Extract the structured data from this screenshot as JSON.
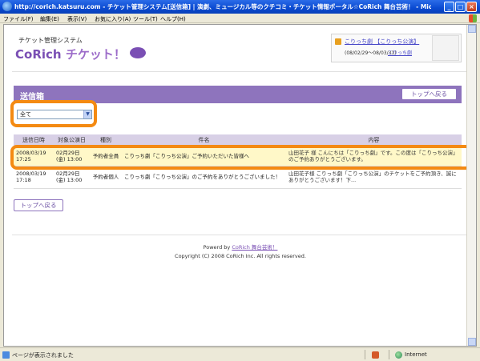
{
  "window": {
    "title": "http://corich.katsuru.com - チケット管理システム[送信箱] | 演劇、ミュージカル等のクチコミ・チケット情報ポータル☆CoRich 舞台芸術！ - Microsoft Inter",
    "minimize": "_",
    "maximize": "□",
    "close": "×"
  },
  "menu": {
    "items": [
      "ファイル(F)",
      "編集(E)",
      "表示(V)",
      "お気に入り(A)",
      "ツール(T)",
      "ヘルプ(H)"
    ]
  },
  "site": {
    "system_name": "チケット管理システム",
    "logo_part1": "CoRich",
    "logo_part2": "チケット！"
  },
  "user": {
    "name_link": "こりっち劇 【こりっち公演】",
    "period": "(08/02/29〜08/03/31)",
    "edit_link": "こりっち劇"
  },
  "outbox": {
    "title": "送信箱",
    "top_button": "トップへ戻る",
    "filter_value": "全て",
    "columns": [
      "送信日時",
      "対象公演日",
      "種別",
      "件名",
      "内容"
    ],
    "rows": [
      {
        "date": "2008/03/19 17:25",
        "perf": "02月29日(金) 13:00",
        "type": "予約者全員",
        "subject": "こりっち劇「こりっち公演」ご予約いただいた皆様へ",
        "body": "山田花子 様 こんにちは「こりっち劇」です。この度は「こりっち公演」のご予約ありがとうございます。"
      },
      {
        "date": "2008/03/19 17:18",
        "perf": "02月29日(金) 13:00",
        "type": "予約者個人",
        "subject": "こりっち劇「こりっち公演」のご予約をありがとうございました！",
        "body": "山田花子様 こりっち劇「こりっち公演」のチケットをご予約頂き、誠にありがとうございます！下..."
      }
    ],
    "bottom_button": "トップへ戻る"
  },
  "footer": {
    "powered_label": "Powerd by",
    "powered_link": "CoRich 舞台芸術！",
    "copyright": "Copyright (C) 2008 CoRich Inc. All rights reserved."
  },
  "status": {
    "text": "ページが表示されました",
    "zone": "Internet"
  }
}
